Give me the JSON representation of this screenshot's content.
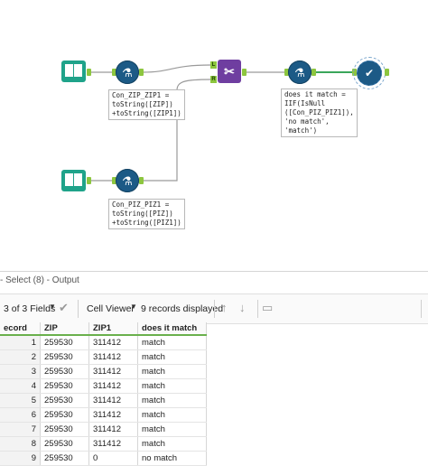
{
  "canvas": {
    "formula1_label": "Con_ZIP_ZIP1 =\ntoString([ZIP])\n+toString([ZIP1])",
    "formula2_label": "Con_PIZ_PIZ1 =\ntoString([PIZ])\n+toString([PIZ1])",
    "formula3_label": "does it match =\nIIF(IsNull\n([Con_PIZ_PIZ1]),\n'no match',\n'match')",
    "join_left_letter": "L",
    "join_right_letter": "R",
    "colors": {
      "input_tool": "#1fa38a",
      "formula_tool": "#1c5a86",
      "join_tool": "#6f3ea0",
      "anchor": "#8dc63f"
    },
    "icons": [
      "book-icon",
      "flask-icon",
      "join-icon",
      "checkmark-icon"
    ]
  },
  "results": {
    "title": "- Select (8) - Output",
    "fields_label": "3 of 3 Fields",
    "viewer_label": "Cell Viewer",
    "records_label": "9 records displayed",
    "columns": [
      "ecord",
      "ZIP",
      "ZIP1",
      "does it match"
    ],
    "rows": [
      [
        "1",
        "259530",
        "311412",
        "match"
      ],
      [
        "2",
        "259530",
        "311412",
        "match"
      ],
      [
        "3",
        "259530",
        "311412",
        "match"
      ],
      [
        "4",
        "259530",
        "311412",
        "match"
      ],
      [
        "5",
        "259530",
        "311412",
        "match"
      ],
      [
        "6",
        "259530",
        "311412",
        "match"
      ],
      [
        "7",
        "259530",
        "311412",
        "match"
      ],
      [
        "8",
        "259530",
        "311412",
        "match"
      ],
      [
        "9",
        "259530",
        "0",
        "no match"
      ]
    ]
  }
}
